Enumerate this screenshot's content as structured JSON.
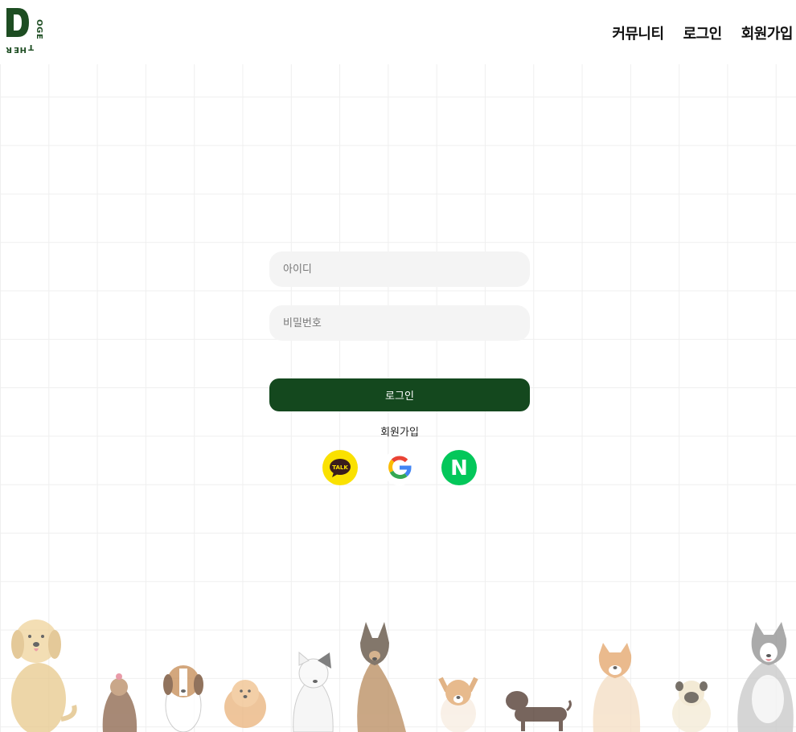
{
  "header": {
    "logo_icon": "dogether-logo-icon",
    "nav": [
      {
        "label": "커뮤니티"
      },
      {
        "label": "로그인"
      },
      {
        "label": "회원가입"
      }
    ]
  },
  "login": {
    "id_placeholder": "아이디",
    "password_placeholder": "비밀번호",
    "submit_label": "로그인",
    "signup_label": "회원가입",
    "social": [
      {
        "icon": "kakaotalk-icon",
        "text": "TALK",
        "color": "#fae100"
      },
      {
        "icon": "google-icon",
        "text": "G"
      },
      {
        "icon": "naver-icon",
        "text": "N",
        "color": "#03c75a"
      }
    ]
  },
  "colors": {
    "brand_green": "#14481e",
    "input_bg": "#f4f4f4",
    "grid_line": "#efefef"
  },
  "decor": {
    "background": "grid-pattern",
    "footer_illustration": "dogs-illustration"
  }
}
